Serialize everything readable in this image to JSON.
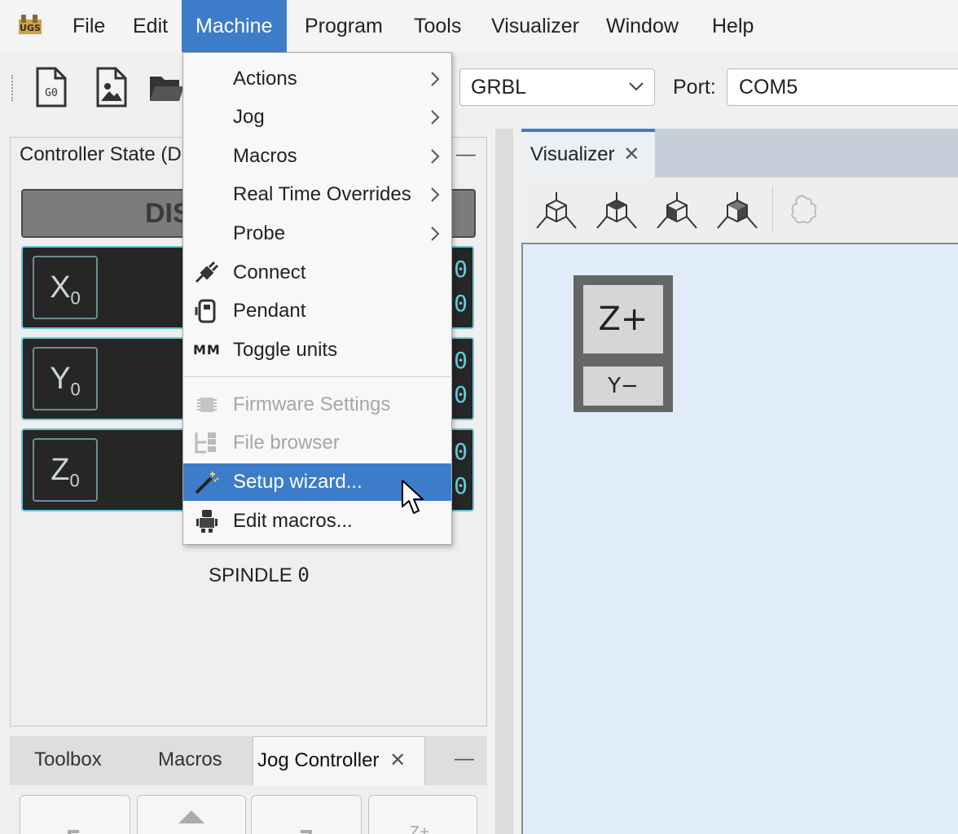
{
  "menubar": {
    "items": [
      "File",
      "Edit",
      "Machine",
      "Program",
      "Tools",
      "Visualizer",
      "Window",
      "Help"
    ],
    "active": "Machine"
  },
  "toolbar": {
    "icons": [
      "gcode-file-icon",
      "image-file-icon",
      "open-folder-icon"
    ],
    "firmware_value": "GRBL",
    "port_label": "Port:",
    "port_value": "COM5"
  },
  "controller_panel": {
    "title": "Controller State (D",
    "minimize": "—",
    "state_text": "DIS",
    "axes": [
      {
        "letter": "X",
        "sub": "0"
      },
      {
        "letter": "Y",
        "sub": "0"
      },
      {
        "letter": "Z",
        "sub": "0"
      }
    ],
    "axis_digits": [
      "0",
      "0"
    ],
    "spindle_label": "SPINDLE",
    "spindle_value": "0"
  },
  "bottom_tabs": {
    "tabs": [
      "Toolbox",
      "Macros",
      "Jog Controller"
    ],
    "close": "✕",
    "minimize": "—",
    "jog_z_label": "Z+"
  },
  "visualizer": {
    "tab_label": "Visualizer",
    "close": "✕",
    "toolbar_icons": [
      "iso-view-icon",
      "top-view-icon",
      "front-view-icon",
      "side-view-icon",
      "move-view-icon"
    ],
    "cube_top": "Z+",
    "cube_front": "Y−"
  },
  "machine_menu": {
    "items": [
      {
        "label": "Actions",
        "icon": "",
        "submenu": true,
        "enabled": true
      },
      {
        "label": "Jog",
        "icon": "",
        "submenu": true,
        "enabled": true
      },
      {
        "label": "Macros",
        "icon": "",
        "submenu": true,
        "enabled": true
      },
      {
        "label": "Real Time Overrides",
        "icon": "",
        "submenu": true,
        "enabled": true
      },
      {
        "label": "Probe",
        "icon": "",
        "submenu": true,
        "enabled": true
      },
      {
        "label": "Connect",
        "icon": "plug-icon",
        "submenu": false,
        "enabled": true
      },
      {
        "label": "Pendant",
        "icon": "pendant-icon",
        "submenu": false,
        "enabled": true
      },
      {
        "label": "Toggle units",
        "icon": "MM",
        "submenu": false,
        "enabled": true
      },
      {
        "label": "Firmware Settings",
        "icon": "chip-icon",
        "submenu": false,
        "enabled": false
      },
      {
        "label": "File browser",
        "icon": "file-tree-icon",
        "submenu": false,
        "enabled": false
      },
      {
        "label": "Setup wizard...",
        "icon": "magic-wand-icon",
        "submenu": false,
        "enabled": true,
        "highlighted": true
      },
      {
        "label": "Edit macros...",
        "icon": "robot-icon",
        "submenu": false,
        "enabled": true
      }
    ]
  },
  "colors": {
    "accent": "#3d7cc9",
    "axis_border": "#64c6d6",
    "canvas_bg": "#e1ecfa",
    "dro_bg": "#262626"
  }
}
